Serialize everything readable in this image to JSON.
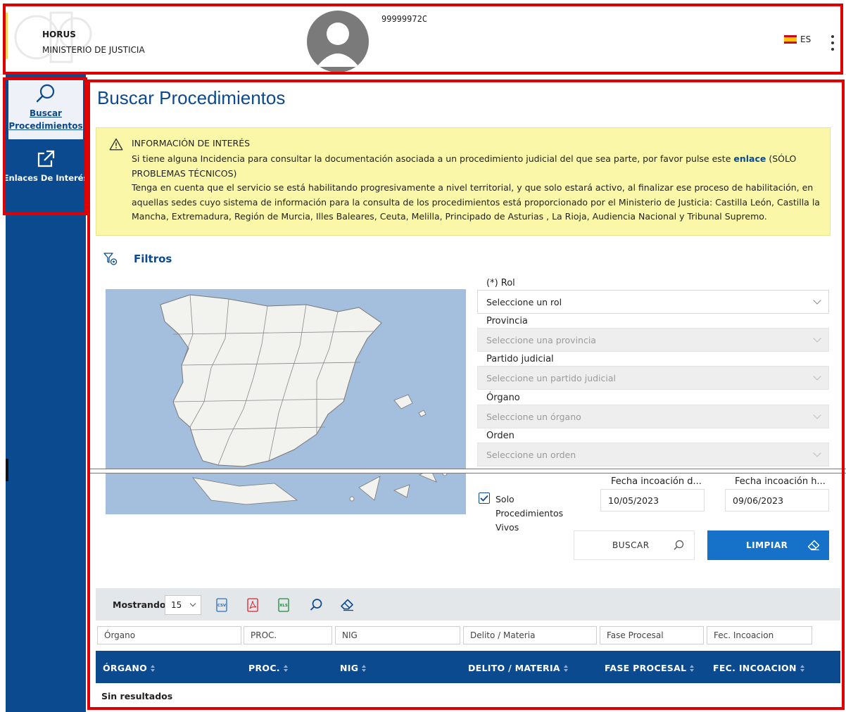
{
  "header": {
    "brand_name": "HORUS",
    "brand_ministry": "MINISTERIO DE JUSTICIA",
    "user_id": "99999972C",
    "language": "ES"
  },
  "sidebar": {
    "items": [
      {
        "label": "Buscar Procedimientos",
        "icon": "search-icon"
      },
      {
        "label": "Enlaces De Interés",
        "icon": "external-link-icon"
      }
    ]
  },
  "main": {
    "title": "Buscar Procedimientos",
    "alert": {
      "heading": "INFORMACIÓN DE INTERÉS",
      "line1_before_link": "Si tiene alguna Incidencia para consultar la documentación asociada a un procedimiento judicial del que sea parte, por favor pulse este ",
      "link_text": "enlace",
      "line1_after_link": " (SÓLO PROBLEMAS TÉCNICOS)",
      "line2": "Tenga en cuenta que el servicio se está habilitando progresivamente a nivel territorial, y que solo estará activo, al finalizar ese proceso de habilitación, en aquellas sedes cuyo sistema de información para la consulta de los procedimientos está proporcionado por el Ministerio de Justicia: Castilla León, Castilla la Mancha, Extremadura, Región de Murcia, Illes Baleares, Ceuta, Melilla, Principado de Asturias , La Rioja, Audiencia Nacional y Tribunal Supremo."
    },
    "filters": {
      "section_label": "Filtros",
      "rol_label": "(*) Rol",
      "rol_value": "Seleccione un rol",
      "provincia_label": "Provincia",
      "provincia_placeholder": "Seleccione una provincia",
      "partido_label": "Partido judicial",
      "partido_placeholder": "Seleccione un partido judicial",
      "organo_label": "Órgano",
      "organo_placeholder": "Seleccione un órgano",
      "orden_label": "Orden",
      "orden_placeholder": "Seleccione un orden",
      "solo_vivos_label": "Solo Procedimientos Vivos",
      "solo_vivos_checked": true,
      "fecha_desde_label": "Fecha incoación d...",
      "fecha_desde_value": "10/05/2023",
      "fecha_hasta_label": "Fecha incoación h...",
      "fecha_hasta_value": "09/06/2023",
      "buscar_label": "BUSCAR",
      "limpiar_label": "LIMPIAR"
    },
    "table": {
      "mostrando_label": "Mostrando",
      "page_size": "15",
      "export_icons": [
        "csv-icon",
        "pdf-icon",
        "xls-icon",
        "search-icon",
        "eraser-icon"
      ],
      "column_filters": [
        "Órgano",
        "PROC.",
        "NIG",
        "Delito / Materia",
        "Fase Procesal",
        "Fec. Incoacion"
      ],
      "headers": [
        "ÓRGANO",
        "PROC.",
        "NIG",
        "DELITO / MATERIA",
        "FASE PROCESAL",
        "FEC. INCOACION"
      ],
      "empty_message": "Sin resultados"
    }
  },
  "colors": {
    "primary_blue": "#0b4a8e",
    "button_blue": "#1672c8",
    "alert_yellow": "#fbf7a8",
    "highlight_red": "#e00000"
  }
}
